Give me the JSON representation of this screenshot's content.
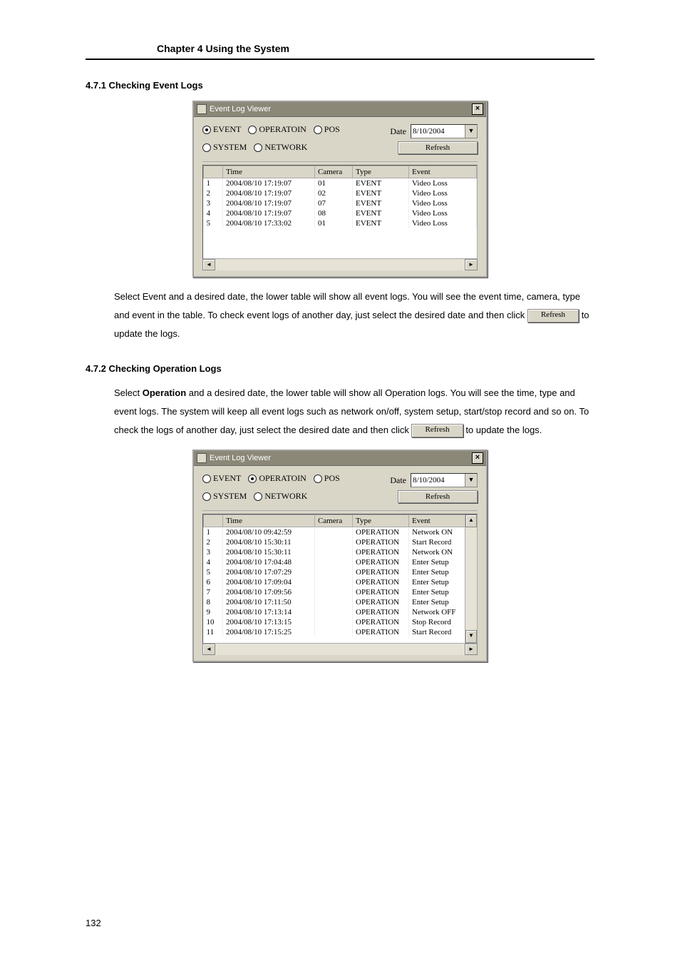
{
  "header": {
    "chapter": "Chapter 4    Using the System"
  },
  "section_471": {
    "title": "4.7.1   Checking Event Logs",
    "body_before": "Select Event and a desired date, the lower table will show all event logs. You will see the event time, camera, type and event in the table. To check event logs of another day, just select the desired date and then click ",
    "refresh_btn": "Refresh",
    "body_after": " to update the logs."
  },
  "section_472": {
    "title": "4.7.2   Checking Operation Logs",
    "body_before": "Select ",
    "bold_word": "Operation",
    "body_mid": " and a desired date, the lower table will show all Operation logs. You will see the time, type and event logs. The system will keep all event logs such as network on/off, system setup, start/stop record and so on. To check the logs of another day, just select the desired date and then click ",
    "refresh_btn": "Refresh",
    "body_after": " to update the logs."
  },
  "dialog1": {
    "title": "Event Log Viewer",
    "radios": {
      "event": "EVENT",
      "operation": "OPERATOIN",
      "pos": "POS",
      "system": "SYSTEM",
      "network": "NETWORK",
      "selected": "event"
    },
    "date_label": "Date",
    "date_value": "8/10/2004",
    "refresh": "Refresh",
    "columns": [
      "",
      "Time",
      "Camera",
      "Type",
      "Event"
    ],
    "rows": [
      {
        "n": "1",
        "time": "2004/08/10 17:19:07",
        "camera": "01",
        "type": "EVENT",
        "event": "Video Loss"
      },
      {
        "n": "2",
        "time": "2004/08/10 17:19:07",
        "camera": "02",
        "type": "EVENT",
        "event": "Video Loss"
      },
      {
        "n": "3",
        "time": "2004/08/10 17:19:07",
        "camera": "07",
        "type": "EVENT",
        "event": "Video Loss"
      },
      {
        "n": "4",
        "time": "2004/08/10 17:19:07",
        "camera": "08",
        "type": "EVENT",
        "event": "Video Loss"
      },
      {
        "n": "5",
        "time": "2004/08/10 17:33:02",
        "camera": "01",
        "type": "EVENT",
        "event": "Video Loss"
      }
    ]
  },
  "dialog2": {
    "title": "Event Log Viewer",
    "radios": {
      "event": "EVENT",
      "operation": "OPERATOIN",
      "pos": "POS",
      "system": "SYSTEM",
      "network": "NETWORK",
      "selected": "operation"
    },
    "date_label": "Date",
    "date_value": "8/10/2004",
    "refresh": "Refresh",
    "columns": [
      "",
      "Time",
      "Camera",
      "Type",
      "Event"
    ],
    "rows": [
      {
        "n": "1",
        "time": "2004/08/10 09:42:59",
        "camera": "",
        "type": "OPERATION",
        "event": "Network ON"
      },
      {
        "n": "2",
        "time": "2004/08/10 15:30:11",
        "camera": "",
        "type": "OPERATION",
        "event": "Start Record"
      },
      {
        "n": "3",
        "time": "2004/08/10 15:30:11",
        "camera": "",
        "type": "OPERATION",
        "event": "Network ON"
      },
      {
        "n": "4",
        "time": "2004/08/10 17:04:48",
        "camera": "",
        "type": "OPERATION",
        "event": "Enter Setup"
      },
      {
        "n": "5",
        "time": "2004/08/10 17:07:29",
        "camera": "",
        "type": "OPERATION",
        "event": "Enter Setup"
      },
      {
        "n": "6",
        "time": "2004/08/10 17:09:04",
        "camera": "",
        "type": "OPERATION",
        "event": "Enter Setup"
      },
      {
        "n": "7",
        "time": "2004/08/10 17:09:56",
        "camera": "",
        "type": "OPERATION",
        "event": "Enter Setup"
      },
      {
        "n": "8",
        "time": "2004/08/10 17:11:50",
        "camera": "",
        "type": "OPERATION",
        "event": "Enter Setup"
      },
      {
        "n": "9",
        "time": "2004/08/10 17:13:14",
        "camera": "",
        "type": "OPERATION",
        "event": "Network OFF"
      },
      {
        "n": "10",
        "time": "2004/08/10 17:13:15",
        "camera": "",
        "type": "OPERATION",
        "event": "Stop Record"
      },
      {
        "n": "11",
        "time": "2004/08/10 17:15:25",
        "camera": "",
        "type": "OPERATION",
        "event": "Start Record"
      }
    ]
  },
  "page_number": "132"
}
